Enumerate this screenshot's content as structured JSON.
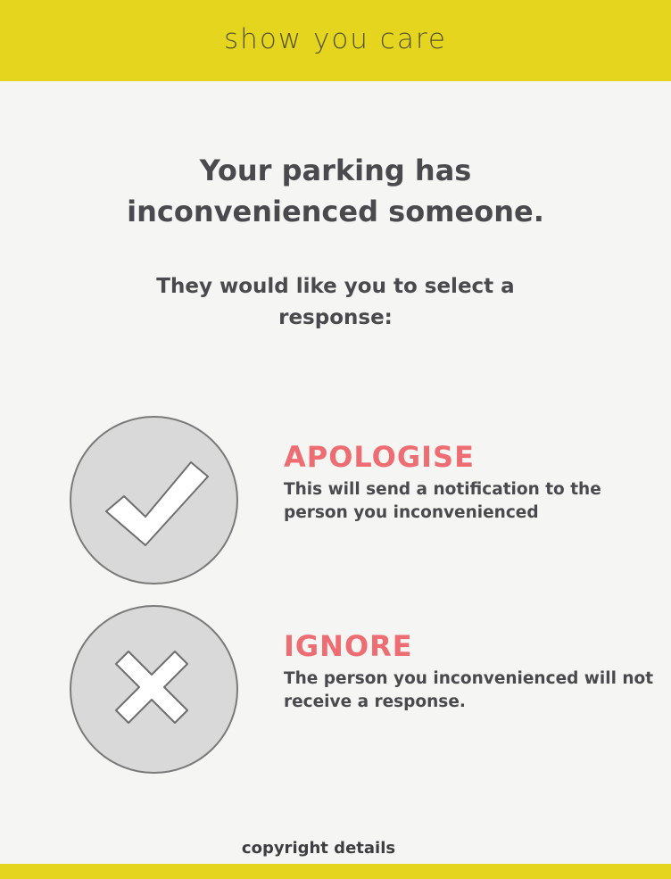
{
  "header": {
    "brand": "show you care"
  },
  "main": {
    "headline": [
      "Your parking has",
      "inconvenienced someone."
    ],
    "subline": [
      "They would like you to select a",
      "response:"
    ]
  },
  "options": [
    {
      "title": "APOLOGISE",
      "description": [
        "This will send a notification to the",
        "person you inconvenienced"
      ],
      "icon": "check-icon"
    },
    {
      "title": "IGNORE",
      "description": [
        "The person you inconvenienced will not",
        "receive a response."
      ],
      "icon": "cross-icon"
    }
  ],
  "footer": {
    "copyright": "copyright details"
  },
  "colors": {
    "brand_yellow": "#e5d51f",
    "accent_red": "#ee6d72",
    "text_dark": "#4a4a4e",
    "background": "#f5f5f3"
  }
}
